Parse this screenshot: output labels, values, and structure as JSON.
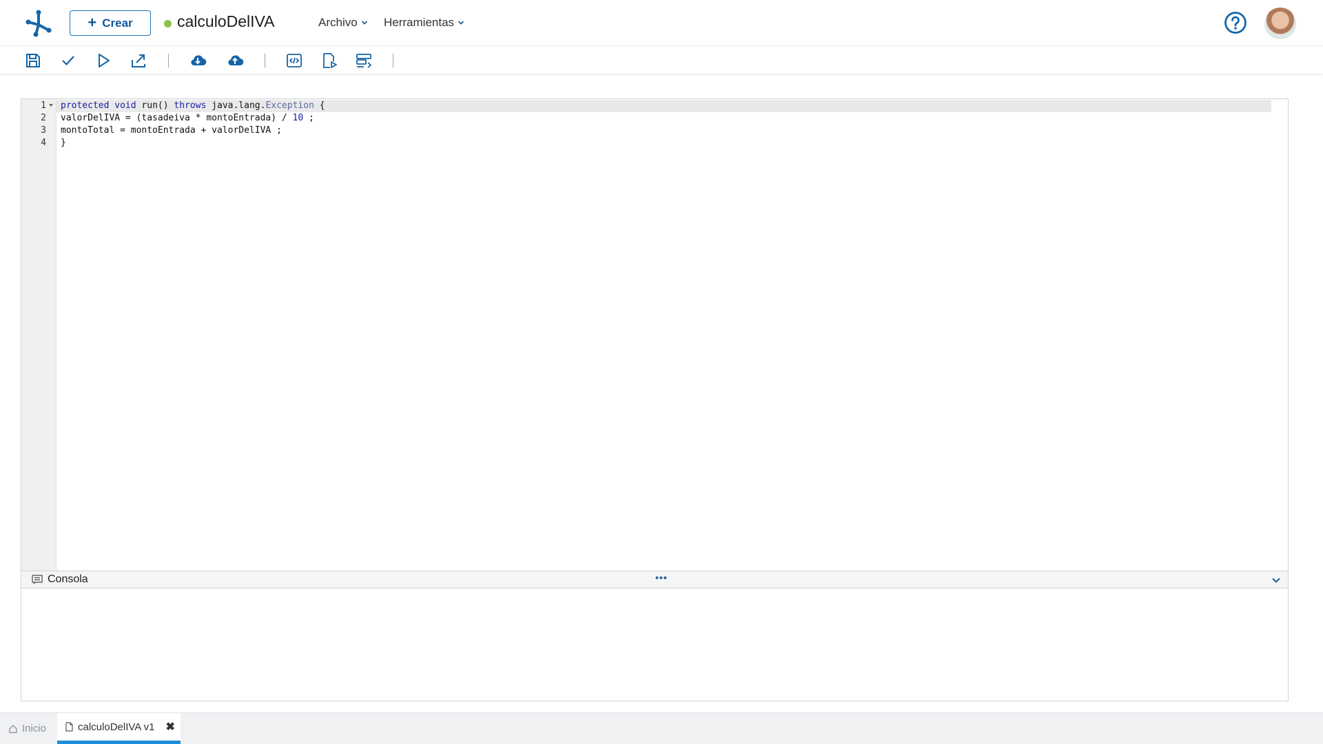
{
  "app": {
    "create_label": "Crear",
    "document_title": "calculoDelIVA",
    "status_color": "#8bc34a",
    "accent_color": "#10579a"
  },
  "menus": [
    {
      "label": "Archivo"
    },
    {
      "label": "Herramientas"
    }
  ],
  "toolbar": {
    "groups": [
      [
        "save-icon",
        "check-icon",
        "run-icon",
        "export-icon"
      ],
      [
        "cloud-download-icon",
        "cloud-upload-icon"
      ],
      [
        "code-view-icon",
        "document-run-icon",
        "list-format-icon"
      ]
    ]
  },
  "editor": {
    "lines": [
      {
        "number": "1",
        "code": "protected void run() throws java.lang.Exception {"
      },
      {
        "number": "2",
        "code": "valorDelIVA = (tasadeiva * montoEntrada) / 10 ;"
      },
      {
        "number": "3",
        "code": "montoTotal = montoEntrada + valorDelIVA ;"
      },
      {
        "number": "4",
        "code": "}"
      }
    ]
  },
  "console": {
    "title": "Consola",
    "more_label": "•••"
  },
  "tabs": [
    {
      "label": "Inicio",
      "icon": "home-icon",
      "active": false
    },
    {
      "label": "calculoDelIVA v1",
      "icon": "document-icon",
      "active": true
    }
  ]
}
